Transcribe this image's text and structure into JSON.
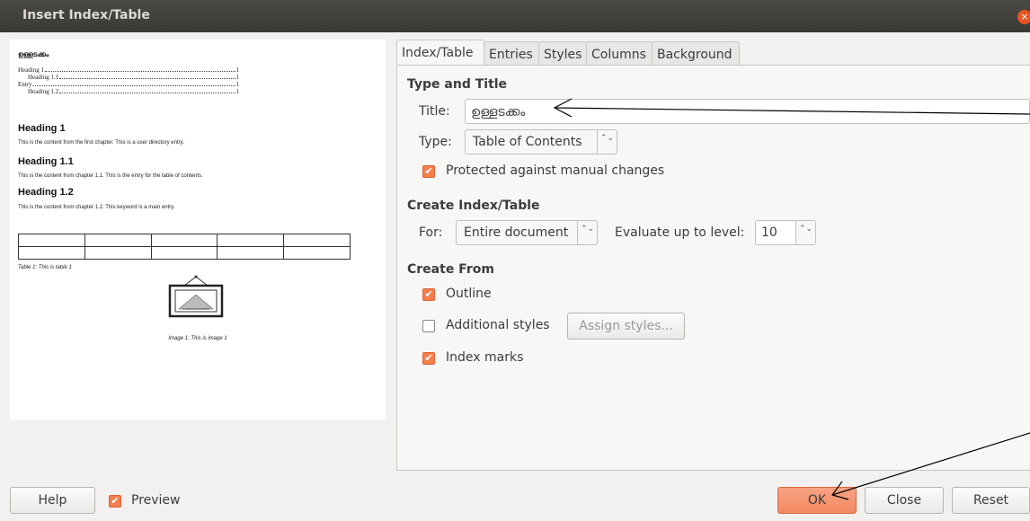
{
  "window": {
    "title": "Insert Index/Table",
    "close_glyph": "×"
  },
  "preview": {
    "toc_title": "ഉള്ളടക്കം",
    "toc": [
      {
        "text": "Heading 1",
        "page": "1"
      },
      {
        "text": "Heading 1.1",
        "page": "1"
      },
      {
        "text": "Entry",
        "page": "1"
      },
      {
        "text": "Heading 1.2",
        "page": "1"
      }
    ],
    "sections": [
      {
        "heading": "Heading 1",
        "body": "This is the content from the first chapter. This is a user directory entry."
      },
      {
        "heading": "Heading 1.1",
        "body": "This is the content from chapter 1.1. This is the entry for the table of contents."
      },
      {
        "heading": "Heading 1.2",
        "body": "This is the content from chapter 1.2. This keyword is a main entry."
      }
    ],
    "table_caption": "Table 1: This is table 1",
    "image_caption": "Image 1: This is image 1"
  },
  "tabs": [
    "Index/Table",
    "Entries",
    "Styles",
    "Columns",
    "Background"
  ],
  "type_title": {
    "heading": "Type and Title",
    "title_label": "Title:",
    "title_value": "ഉള്ളടക്കം",
    "type_label": "Type:",
    "type_value": "Table of Contents",
    "protected_label": "Protected against manual changes",
    "protected_checked": true
  },
  "create_index": {
    "heading": "Create Index/Table",
    "for_label": "For:",
    "for_value": "Entire document",
    "level_label": "Evaluate up to level:",
    "level_value": "10"
  },
  "create_from": {
    "heading": "Create From",
    "outline_label": "Outline",
    "outline_checked": true,
    "additional_label": "Additional styles",
    "additional_checked": false,
    "assign_label": "Assign styles...",
    "index_marks_label": "Index marks",
    "index_marks_checked": true
  },
  "buttons": {
    "help": "Help",
    "preview": "Preview",
    "preview_checked": true,
    "ok": "OK",
    "close": "Close",
    "reset": "Reset"
  },
  "check_glyph": "✔",
  "spin_glyph": "⌃⌄",
  "colors": {
    "accent": "#f47f4d",
    "titlebar": "#3f3e3a",
    "ok_button": "#f28a62"
  }
}
